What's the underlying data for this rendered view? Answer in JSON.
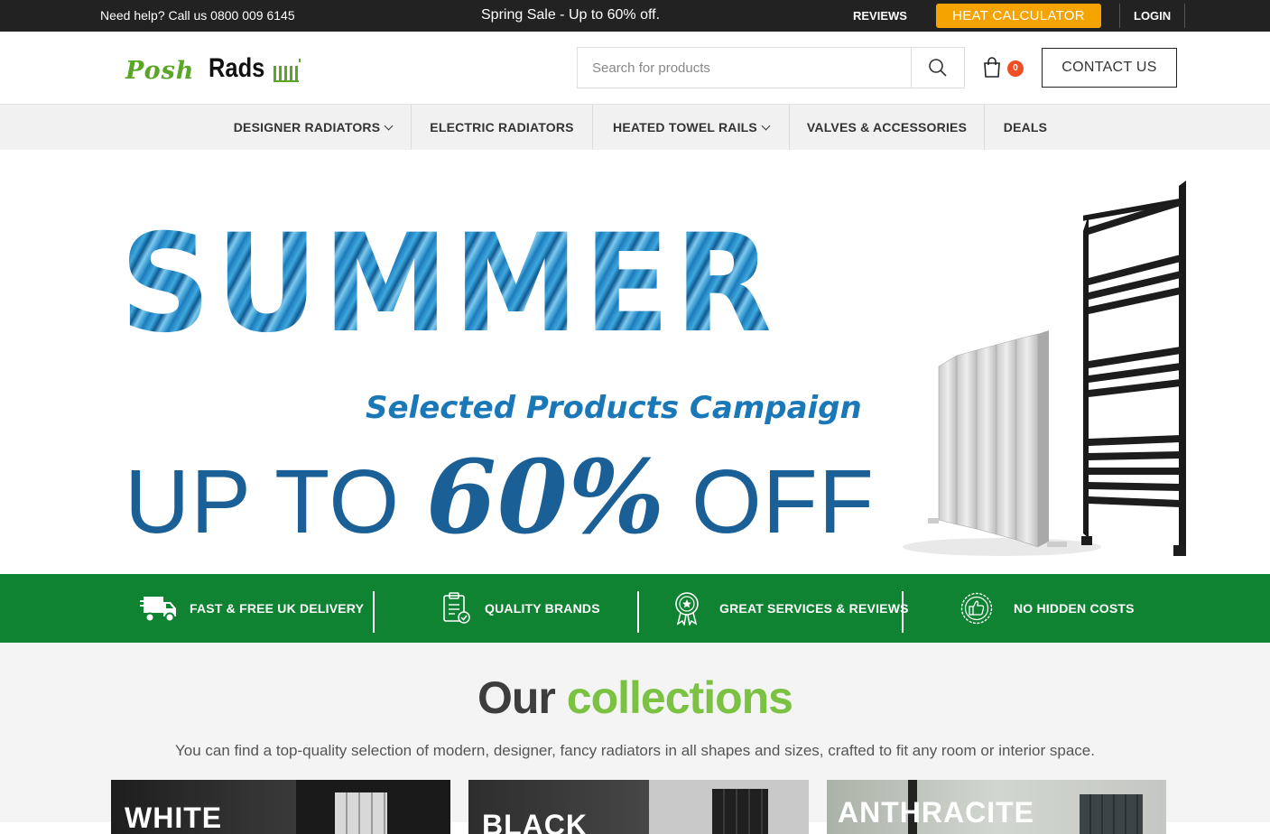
{
  "topbar": {
    "help": "Need help? Call us 0800 009 6145",
    "promo": "Spring Sale - Up to 60% off.",
    "reviews": "REVIEWS",
    "heat_calculator": "HEAT CALCULATOR",
    "login": "LOGIN"
  },
  "header": {
    "logo_posh": "Posh",
    "logo_rads": "Rads",
    "search_placeholder": "Search for products",
    "cart_count": "0",
    "contact": "CONTACT US"
  },
  "nav": {
    "items": [
      {
        "label": "DESIGNER RADIATORS",
        "dropdown": true
      },
      {
        "label": "ELECTRIC RADIATORS",
        "dropdown": false
      },
      {
        "label": "HEATED TOWEL RAILS",
        "dropdown": true
      },
      {
        "label": "VALVES & ACCESSORIES",
        "dropdown": false
      },
      {
        "label": "DEALS",
        "dropdown": false
      }
    ]
  },
  "hero": {
    "headline": "SUMMER",
    "subheadline": "Selected Products Campaign",
    "offer_prefix": "UP TO ",
    "offer_percent": "60%",
    "offer_suffix": " OFF"
  },
  "features": [
    {
      "label": "FAST & FREE UK DELIVERY",
      "icon": "truck-icon"
    },
    {
      "label": "QUALITY BRANDS",
      "icon": "clipboard-check-icon"
    },
    {
      "label": "GREAT SERVICES & REVIEWS",
      "icon": "award-icon"
    },
    {
      "label": "NO HIDDEN COSTS",
      "icon": "thumbs-up-icon"
    }
  ],
  "collections": {
    "title_dark": "Our ",
    "title_green": "collections",
    "description": "You can find a top-quality selection of modern, designer, fancy radiators in all shapes and sizes, crafted to fit any room or interior space.",
    "cards": [
      {
        "label": "WHITE"
      },
      {
        "label": "BLACK"
      },
      {
        "label": "ANTHRACITE"
      }
    ]
  },
  "colors": {
    "green_band": "#0f8332",
    "accent_orange": "#f5a300",
    "brand_green": "#7cc242",
    "badge_red": "#f04e23",
    "hero_blue": "#1a5f95"
  }
}
